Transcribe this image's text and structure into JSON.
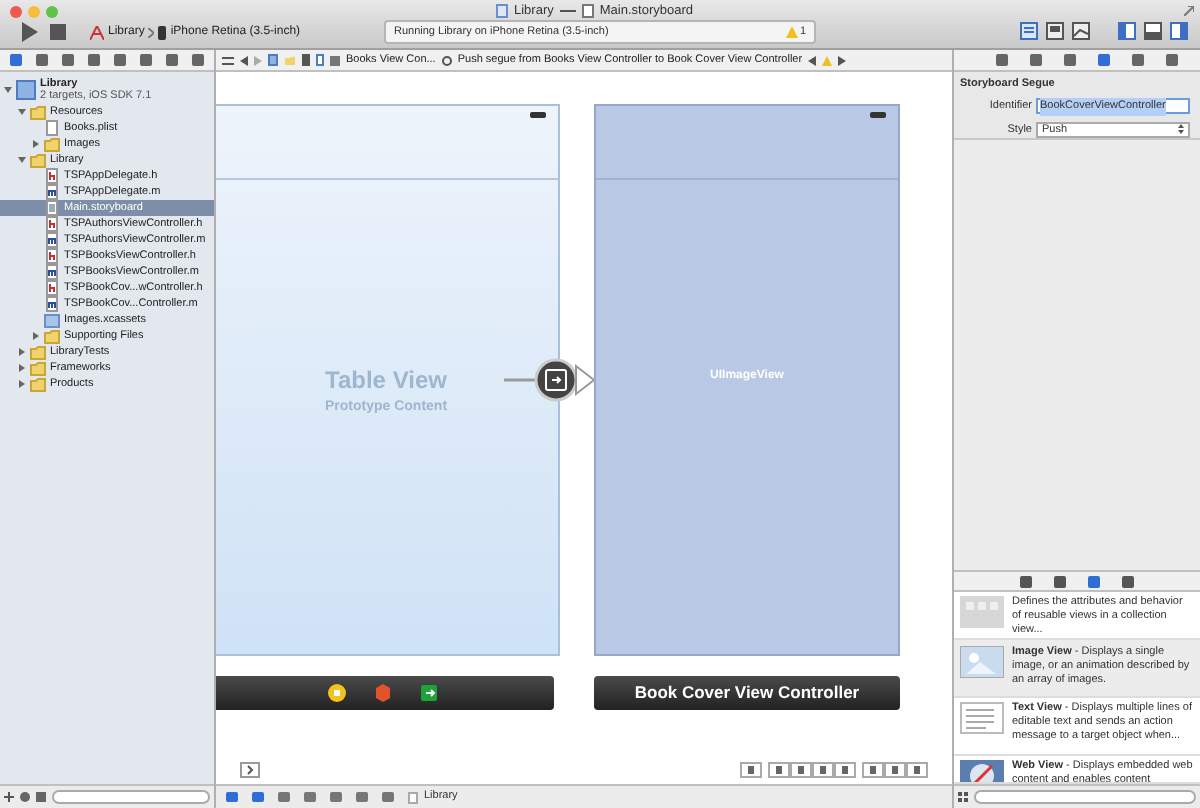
{
  "window": {
    "title_parts": [
      "Library",
      "Main.storyboard"
    ]
  },
  "toolbar": {
    "scheme": "Library",
    "destination": "iPhone Retina (3.5-inch)",
    "activity": "Running Library on iPhone Retina (3.5-inch)",
    "warning_count": "1"
  },
  "navigator": {
    "tabs": [
      {
        "selected": true
      },
      {
        "selected": false
      },
      {
        "selected": false
      },
      {
        "selected": false
      },
      {
        "selected": false
      },
      {
        "selected": false
      },
      {
        "selected": false
      },
      {
        "selected": false
      }
    ],
    "tree": [
      {
        "name": "Library",
        "subtitle": "2 targets, iOS SDK 7.1",
        "kind": "project",
        "expanded": true,
        "selected": false,
        "children": [
          {
            "name": "Resources",
            "kind": "folder",
            "expanded": true,
            "selected": false,
            "children": [
              {
                "name": "Books.plist",
                "kind": "plist",
                "selected": false
              },
              {
                "name": "Images",
                "kind": "folder",
                "expanded": false,
                "selected": false
              }
            ]
          },
          {
            "name": "Library",
            "kind": "folder",
            "expanded": true,
            "selected": false,
            "children": [
              {
                "name": "TSPAppDelegate.h",
                "kind": "h",
                "selected": false
              },
              {
                "name": "TSPAppDelegate.m",
                "kind": "m",
                "selected": false
              },
              {
                "name": "Main.storyboard",
                "kind": "storyboard",
                "selected": true
              },
              {
                "name": "TSPAuthorsViewController.h",
                "kind": "h",
                "selected": false
              },
              {
                "name": "TSPAuthorsViewController.m",
                "kind": "m",
                "selected": false
              },
              {
                "name": "TSPBooksViewController.h",
                "kind": "h",
                "selected": false
              },
              {
                "name": "TSPBooksViewController.m",
                "kind": "m",
                "selected": false
              },
              {
                "name": "TSPBookCov...wController.h",
                "kind": "h",
                "selected": false
              },
              {
                "name": "TSPBookCov...Controller.m",
                "kind": "m",
                "selected": false
              },
              {
                "name": "Images.xcassets",
                "kind": "assets",
                "selected": false
              },
              {
                "name": "Supporting Files",
                "kind": "folder",
                "expanded": false,
                "selected": false
              }
            ]
          },
          {
            "name": "LibraryTests",
            "kind": "folder",
            "expanded": false,
            "selected": false
          },
          {
            "name": "Frameworks",
            "kind": "folder",
            "expanded": false,
            "selected": false
          },
          {
            "name": "Products",
            "kind": "folder",
            "expanded": false,
            "selected": false
          }
        ]
      }
    ]
  },
  "jump_bar": {
    "crumbs": [
      "Books View Con...",
      "Push segue from Books View Controller to Book Cover View Controller"
    ]
  },
  "canvas": {
    "scenes": [
      {
        "kind": "table",
        "title": "Table View",
        "subtitle": "Prototype Content"
      },
      {
        "kind": "image",
        "title": "UIImageView",
        "name": "Book Cover View Controller"
      }
    ]
  },
  "inspector": {
    "tabs": [
      {
        "selected": false
      },
      {
        "selected": false
      },
      {
        "selected": false
      },
      {
        "selected": true
      },
      {
        "selected": false
      },
      {
        "selected": false
      }
    ],
    "section": "Storyboard Segue",
    "identifier_label": "Identifier",
    "identifier": "BookCoverViewController",
    "style_label": "Style",
    "style": "Push"
  },
  "library": {
    "tabs": [
      {
        "selected": false
      },
      {
        "selected": false
      },
      {
        "selected": true
      },
      {
        "selected": false
      }
    ],
    "items": [
      {
        "kind": "collection",
        "description": "Defines the attributes and behavior of reusable views in a collection view..."
      },
      {
        "kind": "image",
        "title": "Image View",
        "description": " - Displays a single image, or an animation described by an array of images."
      },
      {
        "kind": "text",
        "title": "Text View",
        "description": " - Displays multiple lines of editable text and sends an action message to a target object when..."
      },
      {
        "kind": "web",
        "title": "Web View",
        "description": " - Displays embedded web content and enables content"
      }
    ]
  },
  "debug_bar": {
    "target": "Library"
  }
}
